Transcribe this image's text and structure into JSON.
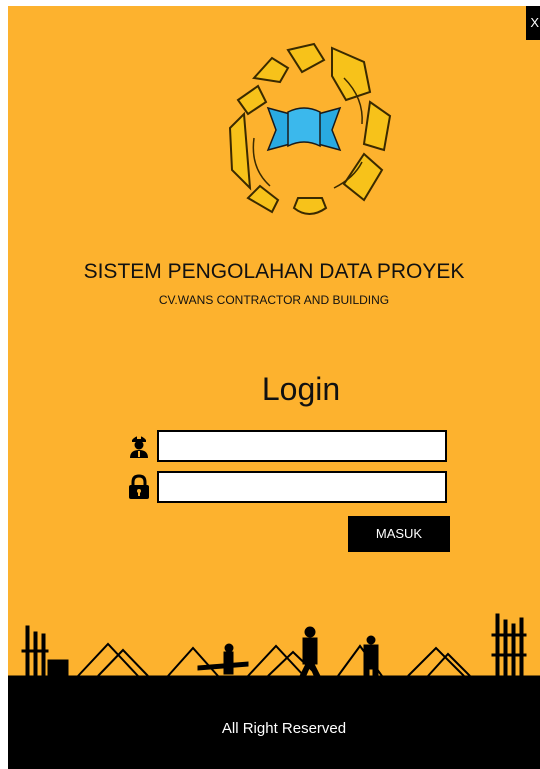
{
  "window": {
    "close_label": "X"
  },
  "header": {
    "title": "SISTEM PENGOLAHAN DATA PROYEK",
    "subtitle": "CV.WANS CONTRACTOR AND BUILDING"
  },
  "login": {
    "heading": "Login",
    "username": {
      "value": "",
      "icon": "user-worker-icon"
    },
    "password": {
      "value": "",
      "icon": "lock-icon"
    },
    "submit_label": "MASUK"
  },
  "footer": {
    "text": "All Right Reserved"
  },
  "colors": {
    "background": "#fdb22e",
    "logo_gear": "#f7c21a",
    "logo_ribbon": "#29aae2",
    "button": "#000000",
    "footer": "#000000"
  }
}
